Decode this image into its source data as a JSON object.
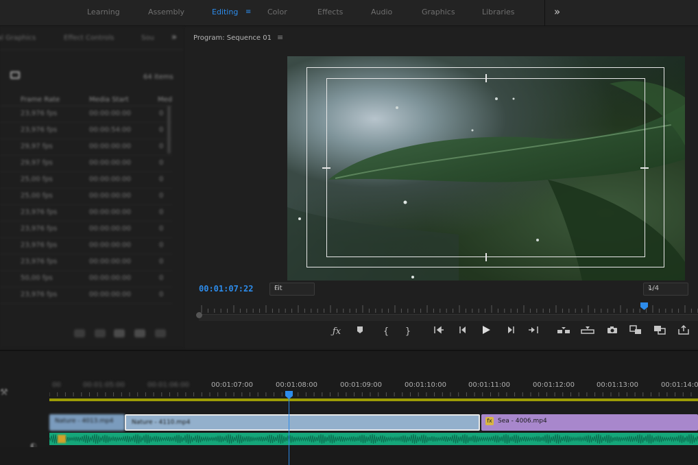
{
  "workspaces": {
    "tabs": [
      {
        "label": "Learning"
      },
      {
        "label": "Assembly"
      },
      {
        "label": "Editing",
        "menu": "≡"
      },
      {
        "label": "Color"
      },
      {
        "label": "Effects"
      },
      {
        "label": "Audio"
      },
      {
        "label": "Graphics"
      },
      {
        "label": "Libraries"
      }
    ],
    "more": "»"
  },
  "project_panel": {
    "tabs": [
      "al Graphics",
      "Effect Controls",
      "Sou"
    ],
    "more": "»",
    "item_count": "64 items",
    "columns": [
      "Frame Rate",
      "Media Start",
      "Med"
    ],
    "rows": [
      {
        "fps": "23,976 fps",
        "start": "00:00:00:00",
        "rest": "0"
      },
      {
        "fps": "23,976 fps",
        "start": "00:00:54:00",
        "rest": "0"
      },
      {
        "fps": "29,97 fps",
        "start": "00:00:00:00",
        "rest": "0"
      },
      {
        "fps": "29,97 fps",
        "start": "00:00:00:00",
        "rest": "0"
      },
      {
        "fps": "25,00 fps",
        "start": "00:00:00:00",
        "rest": "0"
      },
      {
        "fps": "25,00 fps",
        "start": "00:00:00:00",
        "rest": "0"
      },
      {
        "fps": "23,976 fps",
        "start": "00:00:00:00",
        "rest": "0"
      },
      {
        "fps": "23,976 fps",
        "start": "00:00:00:00",
        "rest": "0"
      },
      {
        "fps": "23,976 fps",
        "start": "00:00:00:00",
        "rest": "0"
      },
      {
        "fps": "23,976 fps",
        "start": "00:00:00:00",
        "rest": "0"
      },
      {
        "fps": "50,00 fps",
        "start": "00:00:00:00",
        "rest": "0"
      },
      {
        "fps": "23,976 fps",
        "start": "00:00:00:00",
        "rest": "0"
      }
    ]
  },
  "program_monitor": {
    "title": "Program: Sequence 01",
    "menu": "≡",
    "timecode": "00:01:07:22",
    "zoom": "Fit",
    "resolution": "1/4",
    "controls": [
      "fx",
      "marker",
      "mark-in",
      "mark-out",
      "go-to-in",
      "step-back",
      "play",
      "step-forward",
      "go-to-out",
      "insert",
      "overwrite",
      "export-frame",
      "comparison-view",
      "multi-camera",
      "export"
    ]
  },
  "timeline": {
    "ruler": [
      "00:01:05:00",
      "00:01:06:00",
      "00:01:07:00",
      "00:01:08:00",
      "00:01:09:00",
      "00:01:10:00",
      "00:01:11:00",
      "00:01:12:00",
      "00:01:13:00",
      "00:01:14:00"
    ],
    "clips": [
      {
        "name": "Nature - 4013.mp4"
      },
      {
        "name": "Nature - 4110.mp4"
      },
      {
        "name": "Sea - 4006.mp4"
      }
    ],
    "fx_badge": "fx"
  },
  "colors": {
    "accent": "#2d8ceb",
    "video_clip": "#93b0cc",
    "video_clip_purple": "#a887cc",
    "audio_clip": "#15a77a",
    "work_area": "#c8c800"
  }
}
